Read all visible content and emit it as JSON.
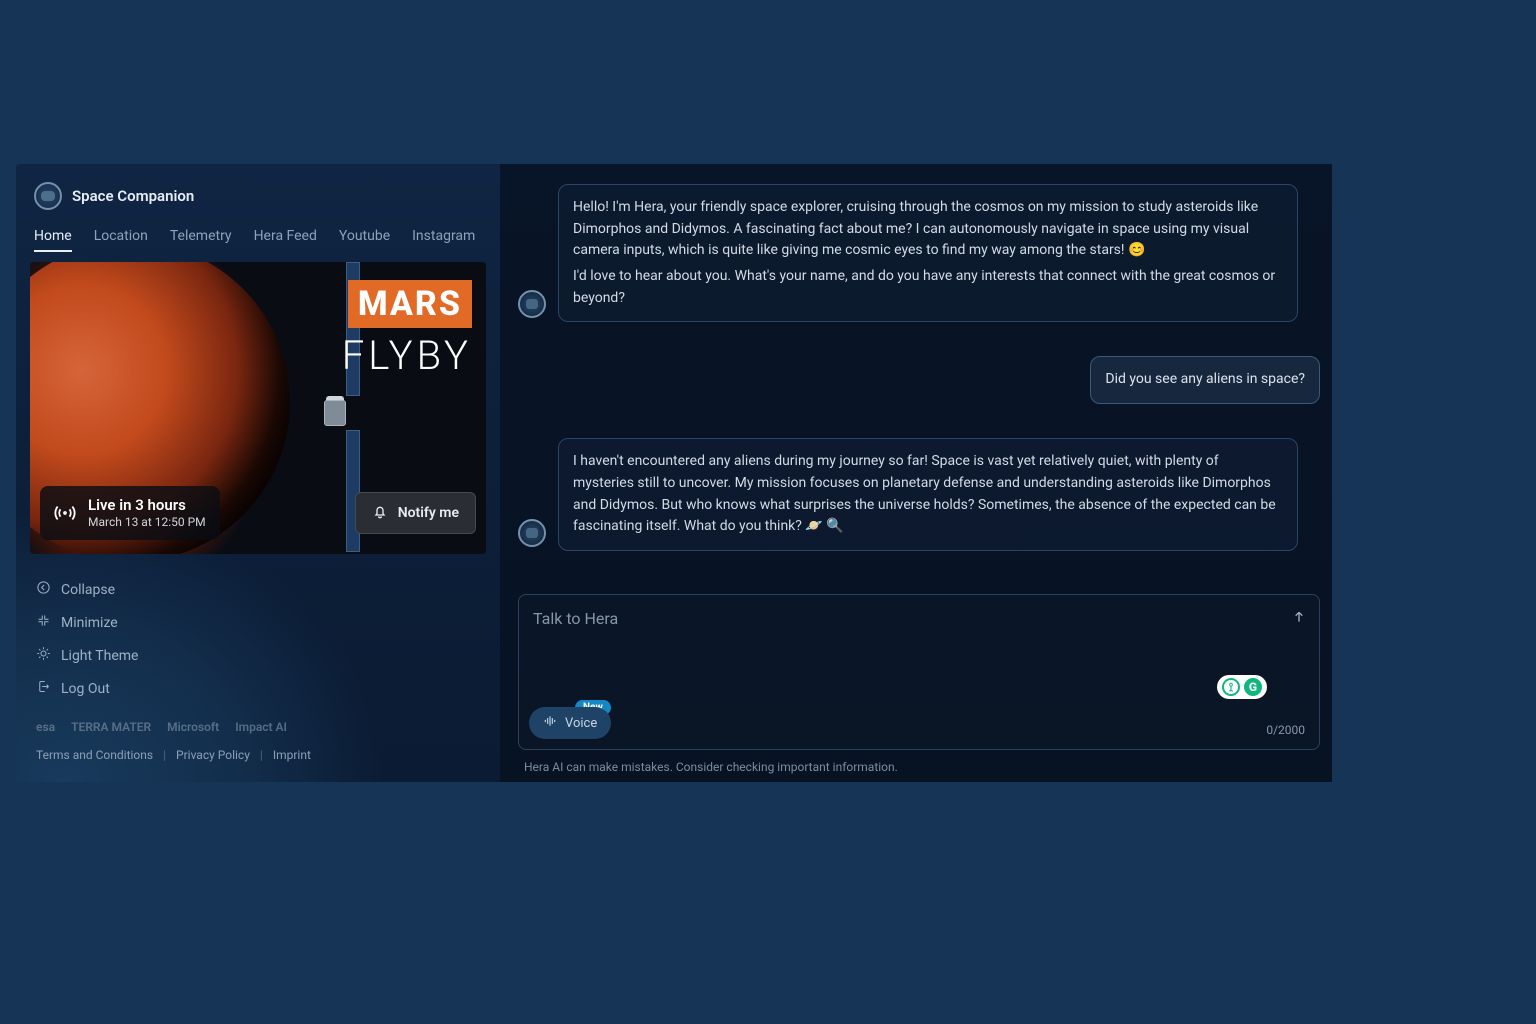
{
  "app": {
    "title": "Space Companion"
  },
  "tabs": {
    "items": [
      "Home",
      "Location",
      "Telemetry",
      "Hera Feed",
      "Youtube",
      "Instagram"
    ],
    "active": 0
  },
  "video": {
    "title_primary": "MARS",
    "title_secondary": "FLYBY",
    "live_in": "Live in 3 hours",
    "live_when": "March 13 at 12:50 PM",
    "notify_label": "Notify me"
  },
  "controls": {
    "collapse": "Collapse",
    "minimize": "Minimize",
    "theme": "Light Theme",
    "logout": "Log Out"
  },
  "partners": [
    "esa",
    "TERRA MATER",
    "Microsoft",
    "Impact AI"
  ],
  "legal": {
    "terms": "Terms and Conditions",
    "privacy": "Privacy Policy",
    "imprint": "Imprint"
  },
  "chat": {
    "messages": [
      {
        "role": "assistant",
        "lines": [
          "Hello! I'm Hera, your friendly space explorer, cruising through the cosmos on my mission to study asteroids like Dimorphos and Didymos. A fascinating fact about me? I can autonomously navigate in space using my visual camera inputs, which is quite like giving me cosmic eyes to find my way among the stars! 😊",
          "I'd love to hear about you. What's your name, and do you have any interests that connect with the great cosmos or beyond?"
        ]
      },
      {
        "role": "user",
        "lines": [
          "Did you see any aliens in space?"
        ]
      },
      {
        "role": "assistant",
        "lines": [
          "I haven't encountered any aliens during my journey so far! Space is vast yet relatively quiet, with plenty of mysteries still to uncover. My mission focuses on planetary defense and understanding asteroids like Dimorphos and Didymos. But who knows what surprises the universe holds? Sometimes, the absence of the expected can be fascinating itself. What do you think? 🪐 🔍"
        ]
      }
    ],
    "input_placeholder": "Talk to Hera",
    "voice_label": "Voice",
    "voice_badge": "New",
    "counter": "0/2000",
    "disclaimer": "Hera AI can make mistakes. Consider checking important information."
  }
}
